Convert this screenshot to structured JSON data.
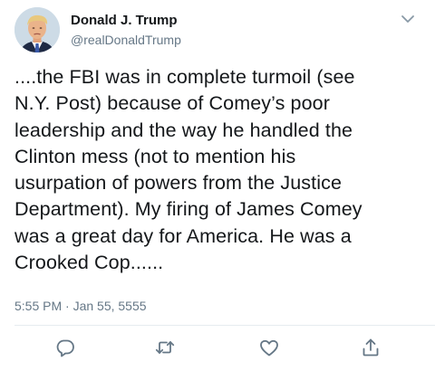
{
  "tweet": {
    "author_name": "Donald J. Trump",
    "author_handle": "@realDonaldTrump",
    "text": "....the FBI was in complete turmoil (see\nN.Y. Post) because of Comey’s poor\nleadership and the way he handled the\nClinton mess (not to mention his\nusurpation of powers from the Justice\nDepartment). My firing of James Comey\nwas a great day for America. He was a\nCrooked Cop......",
    "timestamp": "5:55 PM · Jan 55, 5555"
  },
  "icons": {
    "menu": "chevron-down-icon",
    "reply": "reply-icon",
    "retweet": "retweet-icon",
    "like": "heart-icon",
    "share": "share-icon"
  },
  "colors": {
    "text": "#14171a",
    "secondary": "#657786",
    "divider": "#e6ecf0"
  }
}
